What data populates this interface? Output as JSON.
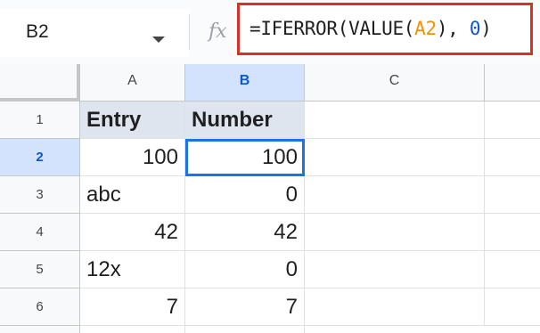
{
  "formula_bar": {
    "name_box": "B2",
    "fx_label": "fx",
    "formula_parts": [
      "=IFERROR(VALUE(",
      "A2",
      "), ",
      "0",
      ")"
    ]
  },
  "columns": [
    "A",
    "B",
    "C"
  ],
  "rows": [
    {
      "num": "1",
      "a": "Entry",
      "b": "Number"
    },
    {
      "num": "2",
      "a": "100",
      "b": "100"
    },
    {
      "num": "3",
      "a": "abc",
      "b": "0"
    },
    {
      "num": "4",
      "a": "42",
      "b": "42"
    },
    {
      "num": "5",
      "a": "12x",
      "b": "0"
    },
    {
      "num": "6",
      "a": "7",
      "b": "7"
    }
  ],
  "selection": {
    "cell": "B2",
    "column": "B",
    "row": "2"
  },
  "colors": {
    "accent": "#1a73e8",
    "formula_highlight_border": "#d93025",
    "header_fill": "#dfe5ee",
    "reference_color": "#f09300",
    "number_color": "#1155cc"
  }
}
